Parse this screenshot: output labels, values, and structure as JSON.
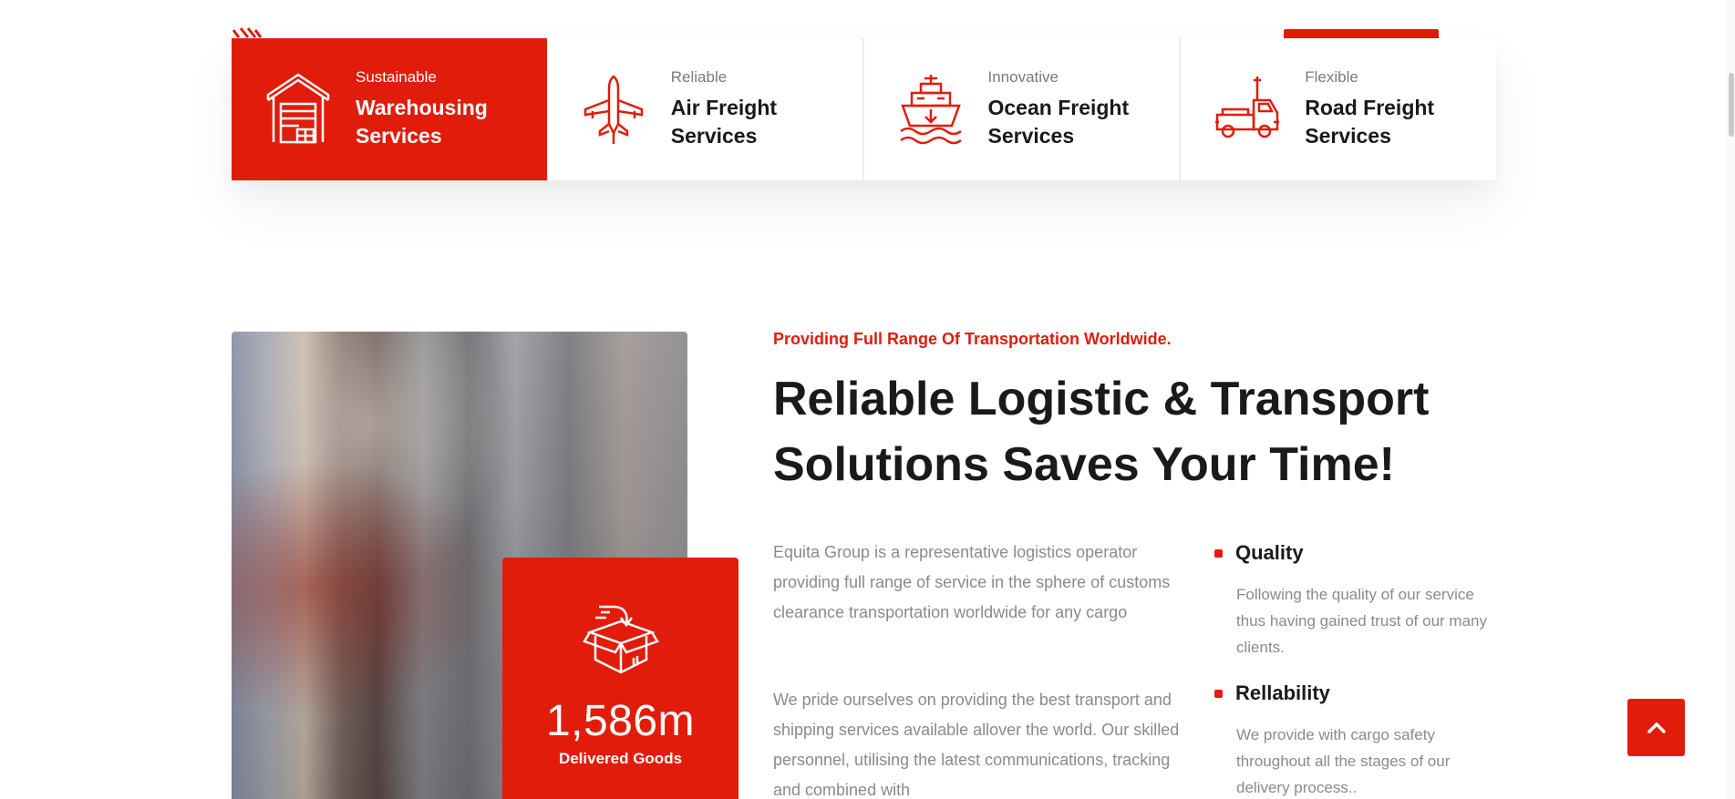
{
  "colors": {
    "accent": "#e11c0b",
    "text": "#1a1a1a",
    "muted": "#8a8a8a"
  },
  "services": [
    {
      "kicker": "Sustainable",
      "title": "Warehousing Services",
      "icon": "warehouse-icon",
      "active": true
    },
    {
      "kicker": "Reliable",
      "title": "Air Freight Services",
      "icon": "airplane-icon",
      "active": false
    },
    {
      "kicker": "Innovative",
      "title": "Ocean Freight Services",
      "icon": "ship-icon",
      "active": false
    },
    {
      "kicker": "Flexible",
      "title": "Road Freight Services",
      "icon": "truck-icon",
      "active": false
    }
  ],
  "about": {
    "eyebrow": "Providing Full Range Of Transportation Worldwide.",
    "headline": "Reliable Logistic & Transport Solutions Saves Your Time!",
    "paragraphs": [
      "Equita Group is a representative logistics operator providing full range of service in the sphere of customs clearance transportation worldwide for any cargo",
      "We pride ourselves on providing the best transport and shipping services available allover the world. Our skilled personnel, utilising the latest communications, tracking and combined with"
    ],
    "stat": {
      "value": "1,586m",
      "label": "Delivered Goods",
      "icon": "box-icon"
    },
    "features": [
      {
        "title": "Quality",
        "text": "Following the quality of our service thus having gained trust of our many clients."
      },
      {
        "title": "Rellability",
        "text": "We provide with cargo safety throughout all the stages of our delivery process.."
      }
    ]
  },
  "back_to_top": {
    "icon": "chevron-up-icon"
  }
}
